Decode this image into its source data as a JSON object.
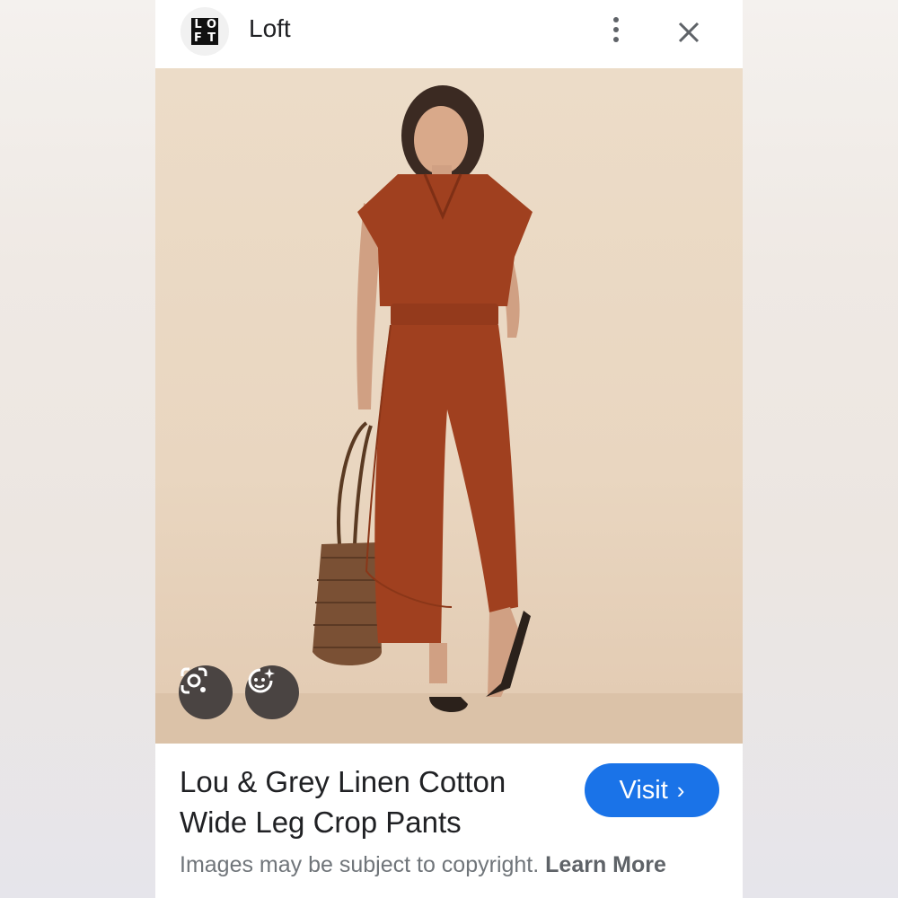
{
  "header": {
    "site_name": "Loft",
    "logo_letters": [
      "L",
      "O",
      "F",
      "T"
    ]
  },
  "product": {
    "title": "Lou & Grey Linen Cotton Wide Leg Crop Pants",
    "visit_label": "Visit",
    "visit_chevron": "›"
  },
  "footer": {
    "copyright_text": "Images may be subject to copyright.",
    "learn_more_label": "Learn More"
  },
  "icons": {
    "more": "more-vert-icon",
    "close": "close-icon",
    "lens": "google-lens-icon",
    "ai": "ai-sparkle-icon"
  },
  "colors": {
    "accent": "#1a73e8",
    "outfit": "#a0401f",
    "background": "#ecdcc8"
  }
}
